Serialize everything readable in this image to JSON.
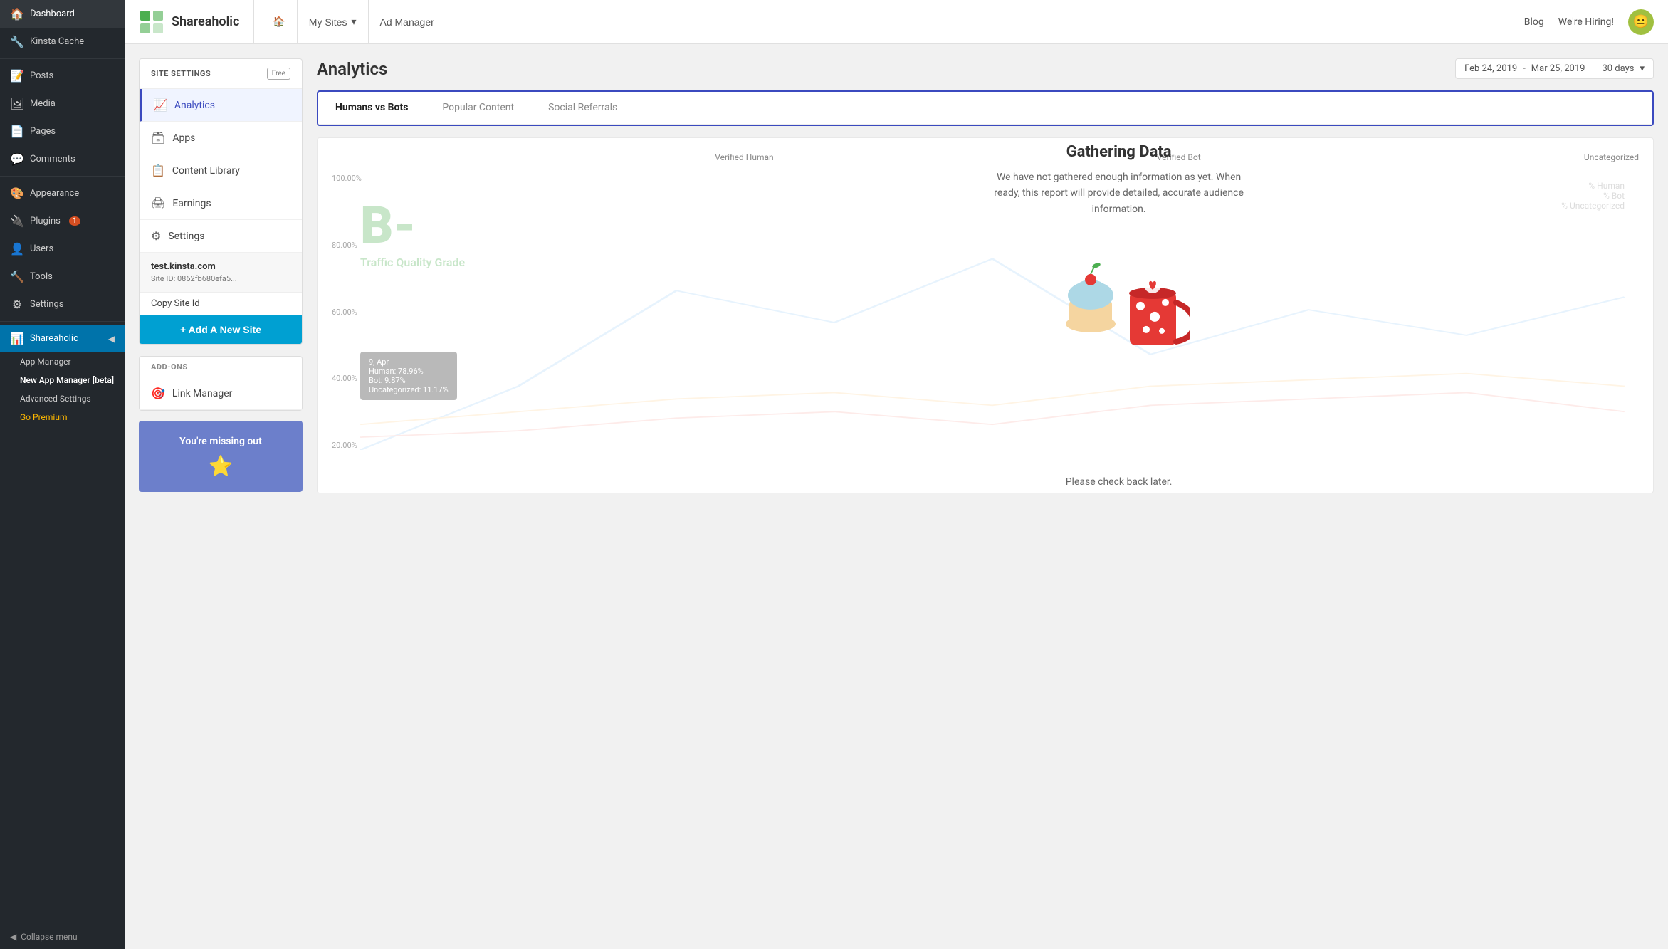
{
  "wp_sidebar": {
    "items": [
      {
        "id": "dashboard",
        "label": "Dashboard",
        "icon": "🏠"
      },
      {
        "id": "kinsta-cache",
        "label": "Kinsta Cache",
        "icon": "🔧"
      },
      {
        "id": "posts",
        "label": "Posts",
        "icon": "📝"
      },
      {
        "id": "media",
        "label": "Media",
        "icon": "🖼"
      },
      {
        "id": "pages",
        "label": "Pages",
        "icon": "📄"
      },
      {
        "id": "comments",
        "label": "Comments",
        "icon": "💬"
      },
      {
        "id": "appearance",
        "label": "Appearance",
        "icon": "🎨"
      },
      {
        "id": "plugins",
        "label": "Plugins",
        "icon": "🔌",
        "badge": "1"
      },
      {
        "id": "users",
        "label": "Users",
        "icon": "👤"
      },
      {
        "id": "tools",
        "label": "Tools",
        "icon": "🔨"
      },
      {
        "id": "settings",
        "label": "Settings",
        "icon": "⚙"
      }
    ],
    "shareaholic": {
      "label": "Shareaholic",
      "icon": "📊",
      "sub_items": [
        {
          "id": "app-manager",
          "label": "App Manager"
        },
        {
          "id": "new-app-manager",
          "label": "New App Manager [beta]"
        },
        {
          "id": "advanced-settings",
          "label": "Advanced Settings"
        },
        {
          "id": "go-premium",
          "label": "Go Premium",
          "highlight": true
        }
      ]
    },
    "collapse_label": "Collapse menu"
  },
  "top_nav": {
    "logo_text": "Shareaholic",
    "home_btn": "🏠",
    "my_sites_label": "My Sites",
    "ad_manager_label": "Ad Manager",
    "blog_label": "Blog",
    "hiring_label": "We're Hiring!",
    "user_emoji": "😐"
  },
  "left_panel": {
    "site_settings_title": "SITE SETTINGS",
    "free_badge": "Free",
    "menu_items": [
      {
        "id": "analytics",
        "label": "Analytics",
        "icon": "📈",
        "active": true
      },
      {
        "id": "apps",
        "label": "Apps",
        "icon": "🗃"
      },
      {
        "id": "content-library",
        "label": "Content Library",
        "icon": "📋"
      },
      {
        "id": "earnings",
        "label": "Earnings",
        "icon": "🖨"
      },
      {
        "id": "settings",
        "label": "Settings",
        "icon": "⚙"
      }
    ],
    "site_domain": "test.kinsta.com",
    "site_id_label": "Site ID:",
    "site_id_value": "0862fb680efa5...",
    "copy_site_id_label": "Copy Site Id",
    "add_site_label": "+ Add A New Site",
    "addons_header": "ADD-ONS",
    "link_manager_label": "Link Manager",
    "link_manager_icon": "🎯",
    "missing_out_label": "You're missing out"
  },
  "analytics": {
    "title": "Analytics",
    "date_start": "Feb 24, 2019",
    "date_separator": "-",
    "date_end": "Mar 25, 2019",
    "date_range": "30 days",
    "tabs": [
      {
        "id": "humans-vs-bots",
        "label": "Humans vs Bots",
        "active": true
      },
      {
        "id": "popular-content",
        "label": "Popular Content"
      },
      {
        "id": "social-referrals",
        "label": "Social Referrals"
      }
    ],
    "gathering_title": "Gathering Data",
    "gathering_desc": "We have not gathered enough information as yet. When ready, this report will provide detailed, accurate audience information.",
    "check_back": "Please check back later.",
    "traffic_grade_letter": "B-",
    "traffic_grade_label": "Traffic Quality Grade",
    "chart_labels": [
      "Verified Human",
      "Verified Bot",
      "Uncategorized"
    ],
    "chart_legend": [
      "% Human",
      "% Bot",
      "% Uncategorized"
    ],
    "chart_y_values": [
      "100.00%",
      "80.00%",
      "60.00%",
      "40.00%",
      "20.00%"
    ],
    "tooltip_date": "9, Apr",
    "tooltip_human": "Human: 78.96%",
    "tooltip_bot": "Bot: 9.87%",
    "tooltip_uncategorized": "Uncategorized: 11.17%"
  }
}
